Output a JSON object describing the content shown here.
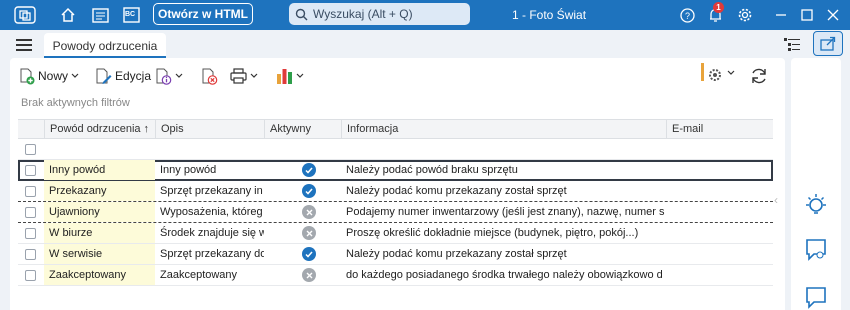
{
  "topbar": {
    "open_html_label": "Otwórz w HTML",
    "search_placeholder": "Wyszukaj (Alt + Q)",
    "company": "1 - Foto Świat",
    "notification_count": "1",
    "bc_label": "BC"
  },
  "tab": {
    "label": "Powody odrzucenia"
  },
  "toolbar": {
    "new_label": "Nowy",
    "edit_label": "Edycja"
  },
  "filters": {
    "text": "Brak aktywnych filtrów"
  },
  "grid": {
    "columns": [
      "Powód odrzucenia ↑",
      "Opis",
      "Aktywny",
      "Informacja",
      "E-mail"
    ],
    "rows": [
      {
        "powod": "Inny powód",
        "opis": "Inny powód",
        "aktywny": true,
        "informacja": "Należy podać powód braku sprzętu",
        "email": ""
      },
      {
        "powod": "Przekazany",
        "opis": "Sprzęt przekazany in",
        "aktywny": true,
        "informacja": "Należy podać komu przekazany został sprzęt",
        "email": ""
      },
      {
        "powod": "Ujawniony",
        "opis": "Wyposażenia, któreg",
        "aktywny": false,
        "informacja": "Podajemy numer inwentarzowy (jeśli jest znany), nazwę, numer s",
        "email": ""
      },
      {
        "powod": "W biurze",
        "opis": "Środek znajduje się w",
        "aktywny": false,
        "informacja": "Proszę określić dokładnie miejsce (budynek, piętro, pokój...)",
        "email": ""
      },
      {
        "powod": "W serwisie",
        "opis": "Sprzęt przekazany do",
        "aktywny": true,
        "informacja": "Należy podać komu przekazany został sprzęt",
        "email": ""
      },
      {
        "powod": "Zaakceptowany",
        "opis": "Zaakceptowany",
        "aktywny": false,
        "informacja": "do każdego posiadanego środka trwałego należy obowiązkowo d",
        "email": ""
      }
    ]
  },
  "colors": {
    "accent": "#1e73be",
    "key_column": "#fdfbd9",
    "chart_icon": [
      "#e8a33b",
      "#e03a3a",
      "#2e9e4a"
    ]
  }
}
